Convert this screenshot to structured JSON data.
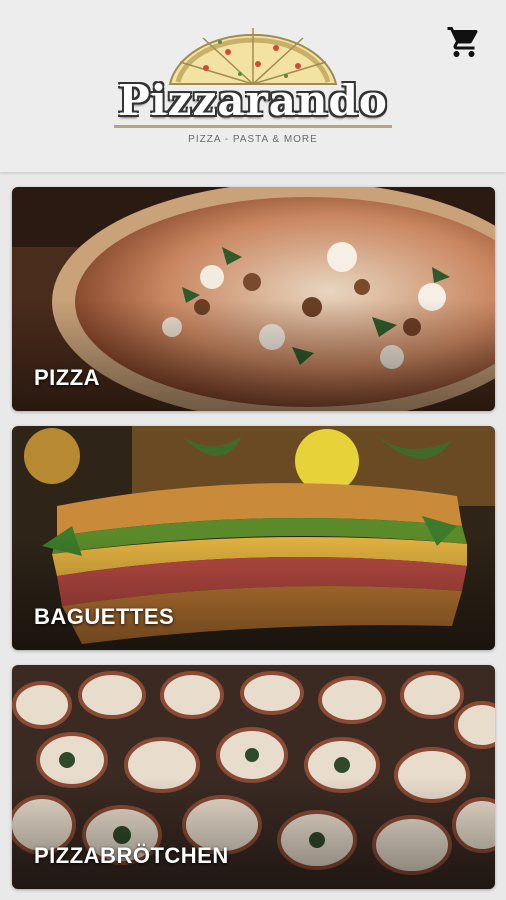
{
  "header": {
    "logo_name": "Pizzarando",
    "logo_tagline": "PIZZA - PASTA & MORE",
    "cart_icon": "shopping-cart-icon"
  },
  "categories": [
    {
      "label": "PIZZA"
    },
    {
      "label": "BAGUETTES"
    },
    {
      "label": "PIZZABRÖTCHEN"
    }
  ],
  "colors": {
    "header_bg": "#ededed",
    "page_bg": "#e9e9e9",
    "accent_gold": "#b9a770"
  }
}
